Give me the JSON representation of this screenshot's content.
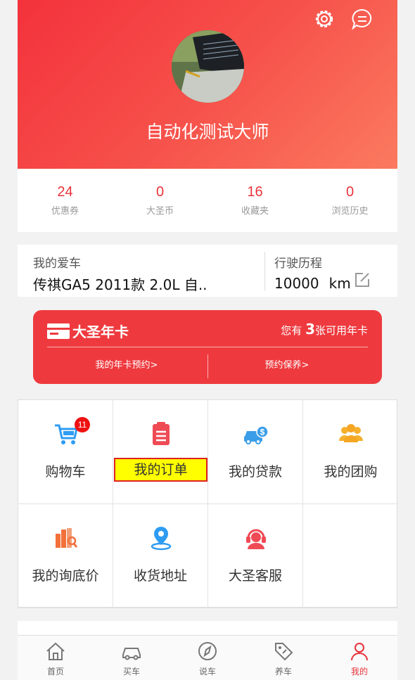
{
  "header": {
    "username": "自动化测试大师",
    "icons": [
      "gear-icon",
      "message-icon"
    ]
  },
  "stats": [
    {
      "value": "24",
      "label": "优惠券"
    },
    {
      "value": "0",
      "label": "大圣币"
    },
    {
      "value": "16",
      "label": "收藏夹"
    },
    {
      "value": "0",
      "label": "浏览历史"
    }
  ],
  "car": {
    "label": "我的爱车",
    "model": "传祺GA5 2011款 2.0L 自..",
    "mileage_label": "行驶历程",
    "mileage_value": "10000",
    "mileage_unit": "km"
  },
  "annual_card": {
    "title": "大圣年卡",
    "count_prefix": "您有",
    "count": "3",
    "count_suffix": "张可用年卡",
    "link_left": "我的年卡预约>",
    "link_right": "预约保养>"
  },
  "grid": [
    {
      "label": "购物车",
      "icon": "cart-icon",
      "badge": "11"
    },
    {
      "label": "我的订单",
      "icon": "order-icon"
    },
    {
      "label": "我的贷款",
      "icon": "loan-icon"
    },
    {
      "label": "我的团购",
      "icon": "group-icon"
    },
    {
      "label": "我的询底价",
      "icon": "inquiry-icon"
    },
    {
      "label": "收货地址",
      "icon": "location-icon"
    },
    {
      "label": "大圣客服",
      "icon": "service-icon"
    }
  ],
  "tabs": [
    {
      "label": "首页",
      "icon": "home-icon"
    },
    {
      "label": "买车",
      "icon": "car-icon"
    },
    {
      "label": "说车",
      "icon": "compass-icon"
    },
    {
      "label": "养车",
      "icon": "tag-icon"
    },
    {
      "label": "我的",
      "icon": "user-icon",
      "active": true
    }
  ],
  "colors": {
    "accent": "#e8333b",
    "highlight": "#ffff00"
  }
}
